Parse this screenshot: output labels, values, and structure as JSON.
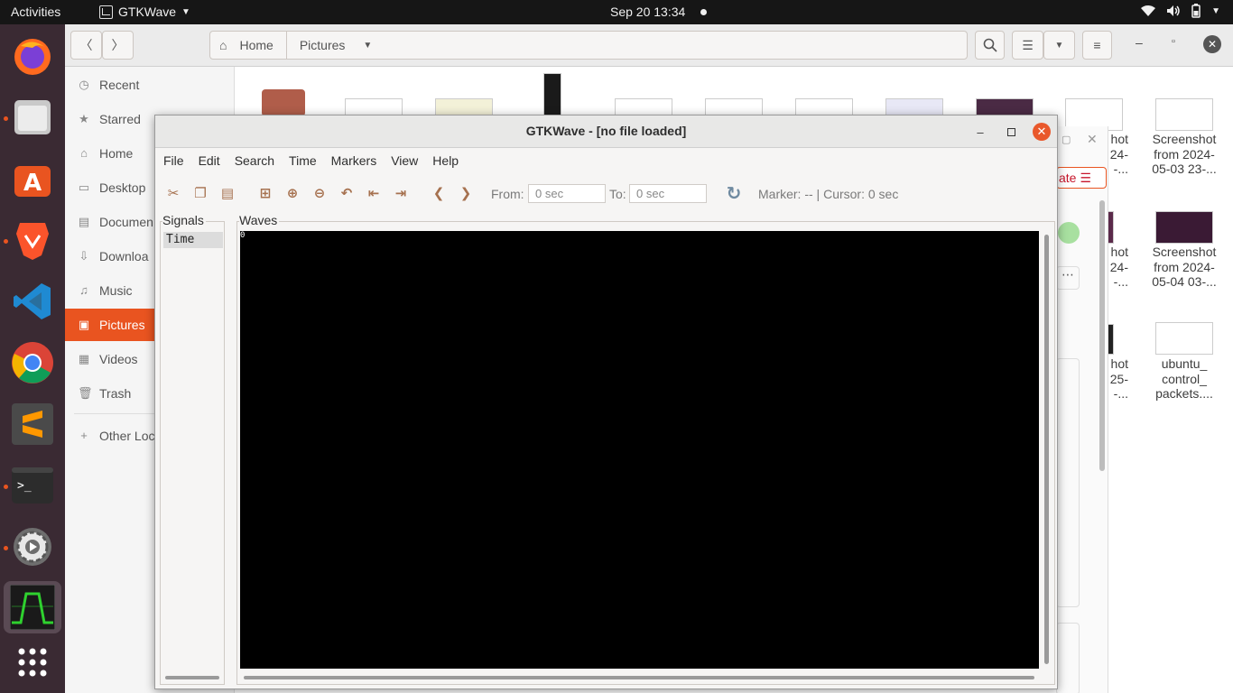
{
  "topbar": {
    "activities": "Activities",
    "app_name": "GTKWave",
    "clock": "Sep 20  13:34"
  },
  "dock": {
    "items": [
      "firefox-icon",
      "files-icon",
      "app-center-icon",
      "brave-icon",
      "vscode-icon",
      "chrome-icon",
      "sublime-icon",
      "terminal-icon",
      "settings-icon",
      "gtkwave-icon",
      "apps-grid-icon"
    ]
  },
  "files": {
    "path_home": "Home",
    "path_current": "Pictures",
    "sidebar": [
      {
        "label": "Recent",
        "icon": "clock-icon"
      },
      {
        "label": "Starred",
        "icon": "star-icon"
      },
      {
        "label": "Home",
        "icon": "home-icon"
      },
      {
        "label": "Desktop",
        "icon": "desktop-icon"
      },
      {
        "label": "Documen",
        "icon": "document-icon"
      },
      {
        "label": "Downloa",
        "icon": "download-icon"
      },
      {
        "label": "Music",
        "icon": "music-icon"
      },
      {
        "label": "Pictures",
        "icon": "picture-icon"
      },
      {
        "label": "Videos",
        "icon": "video-icon"
      },
      {
        "label": "Trash",
        "icon": "trash-icon"
      },
      {
        "label": "Other Loc",
        "icon": "plus-icon"
      }
    ],
    "thumb_labels": [
      [
        "Screenshot",
        "from 2024-",
        "05-03 23-..."
      ],
      [
        "Screenshot",
        "from 2024-",
        "05-04 03-..."
      ],
      [
        "ubuntu_",
        "control_",
        "packets...."
      ]
    ],
    "partial_labels": [
      [
        "hot",
        "24-",
        "-..."
      ],
      [
        "hot",
        "24-",
        "-..."
      ],
      [
        "hot",
        "25-",
        "-..."
      ]
    ],
    "partial_button": "ate"
  },
  "gtkwave": {
    "title": "GTKWave - [no file loaded]",
    "menu": [
      "File",
      "Edit",
      "Search",
      "Time",
      "Markers",
      "View",
      "Help"
    ],
    "from_label": "From:",
    "from_value": "0 sec",
    "to_label": "To:",
    "to_value": "0 sec",
    "marker_text": "Marker: --  |  Cursor: 0 sec",
    "signals_label": "Signals",
    "signals": [
      "Time"
    ],
    "waves_label": "Waves",
    "wave_zero": "0"
  }
}
